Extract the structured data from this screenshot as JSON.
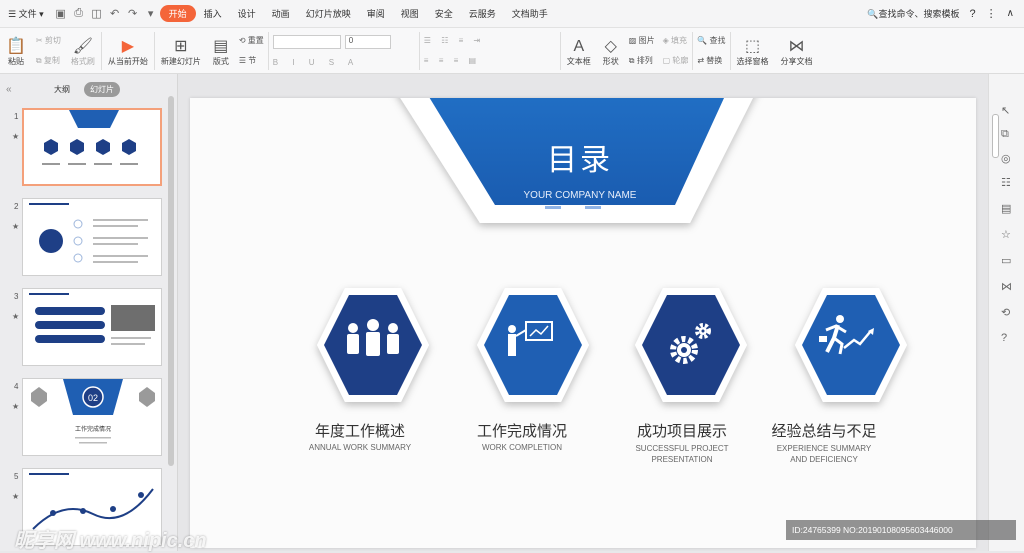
{
  "menubar": {
    "file": "文件",
    "tabs": [
      {
        "label": "开始",
        "active": true
      },
      {
        "label": "插入"
      },
      {
        "label": "设计"
      },
      {
        "label": "动画"
      },
      {
        "label": "幻灯片放映"
      },
      {
        "label": "审阅"
      },
      {
        "label": "视图"
      },
      {
        "label": "安全"
      },
      {
        "label": "云服务"
      },
      {
        "label": "文档助手"
      }
    ],
    "search": "查找命令、搜索模板"
  },
  "ribbon": {
    "paste": "粘贴",
    "cut": "剪切",
    "copy": "复制",
    "format_painter": "格式刷",
    "from_current": "从当前开始",
    "new_slide": "新建幻灯片",
    "layout": "版式",
    "reset": "重置",
    "section": "节",
    "font_size": "0",
    "textbox": "文本框",
    "shape": "形状",
    "picture": "图片",
    "arrange": "排列",
    "fill": "填充",
    "outline": "轮廓",
    "find": "查找",
    "replace": "替换",
    "select_pane": "选择窗格",
    "share": "分享文档"
  },
  "sidebar": {
    "tab_outline": "大纲",
    "tab_slides": "幻灯片",
    "thumb4_number": "02",
    "thumb4_title": "工作完成情况"
  },
  "slide": {
    "title": "目录",
    "subtitle": "YOUR COMPANY NAME",
    "items": [
      {
        "cn": "年度工作概述",
        "en": [
          "ANNUAL WORK SUMMARY"
        ]
      },
      {
        "cn": "工作完成情况",
        "en": [
          "WORK COMPLETION"
        ]
      },
      {
        "cn": "成功项目展示",
        "en": [
          "SUCCESSFUL PROJECT",
          "PRESENTATION"
        ]
      },
      {
        "cn": "经验总结与不足",
        "en": [
          "EXPERIENCE SUMMARY",
          "AND DEFICIENCY"
        ]
      }
    ]
  },
  "watermark": "昵享网 www.nipic.cn",
  "image_id": "ID:24765399 NO:20190108095603446000",
  "colors": {
    "accent": "#f4653a",
    "brand_blue": "#1f5fb3",
    "dark_blue": "#1e3f86"
  }
}
